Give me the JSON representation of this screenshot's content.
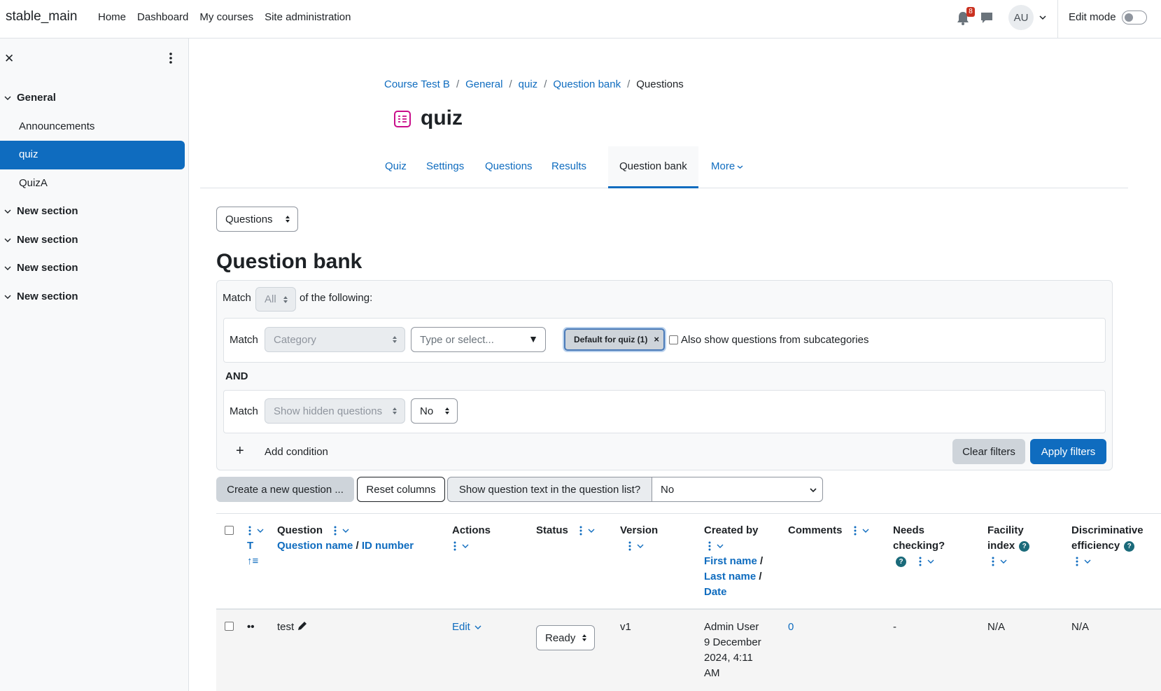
{
  "navbar": {
    "brand": "stable_main",
    "items": [
      "Home",
      "Dashboard",
      "My courses",
      "Site administration"
    ],
    "notification_count": "8",
    "avatar_initials": "AU",
    "edit_mode_label": "Edit mode"
  },
  "sidebar": {
    "sections": [
      {
        "label": "General",
        "items": [
          "Announcements",
          "quiz",
          "QuizA"
        ]
      },
      {
        "label": "New section"
      },
      {
        "label": "New section"
      },
      {
        "label": "New section"
      },
      {
        "label": "New section"
      }
    ],
    "active_item": "quiz"
  },
  "breadcrumb": [
    "Course Test B",
    "General",
    "quiz",
    "Question bank",
    "Questions"
  ],
  "page": {
    "title": "quiz",
    "tabs": [
      "Quiz",
      "Settings",
      "Questions",
      "Results",
      "Question bank",
      "More"
    ],
    "active_tab": "Question bank",
    "view_select": "Questions",
    "heading": "Question bank"
  },
  "filters": {
    "match_label": "Match",
    "match_value": "All",
    "of_following": "of the following:",
    "condition1": {
      "match_label": "Match",
      "field": "Category",
      "type_placeholder": "Type or select...",
      "chip": "Default for quiz (1)",
      "chip_remove": "×",
      "subcategories_label": "Also show questions from subcategories"
    },
    "join": "AND",
    "condition2": {
      "match_label": "Match",
      "field": "Show hidden questions",
      "value": "No"
    },
    "add_condition": "Add condition",
    "clear_filters": "Clear filters",
    "apply_filters": "Apply filters"
  },
  "toolbar": {
    "create_question": "Create a new question ...",
    "reset_columns": "Reset columns",
    "show_text_label": "Show question text in the question list?",
    "show_text_value": "No"
  },
  "table": {
    "headers": {
      "sort_t": "T",
      "question": "Question",
      "question_name": "Question name",
      "slash": "/",
      "id_number": "ID number",
      "actions": "Actions",
      "status": "Status",
      "version": "Version",
      "created_by": "Created by",
      "first_name": "First name",
      "last_name": "Last name",
      "date": "Date",
      "comments": "Comments",
      "needs_checking_1": "Needs",
      "needs_checking_2": "checking?",
      "facility_1": "Facility",
      "facility_2": "index",
      "discrim_1": "Discriminative",
      "discrim_2": "efficiency"
    },
    "rows": [
      {
        "name": "test",
        "action": "Edit",
        "status": "Ready",
        "version": "v1",
        "created_by": "Admin User",
        "date_line1": "9 December",
        "date_line2": "2024, 4:11",
        "date_line3": "AM",
        "comments": "0",
        "needs_checking": "-",
        "facility": "N/A",
        "discrimination": "N/A"
      }
    ]
  }
}
